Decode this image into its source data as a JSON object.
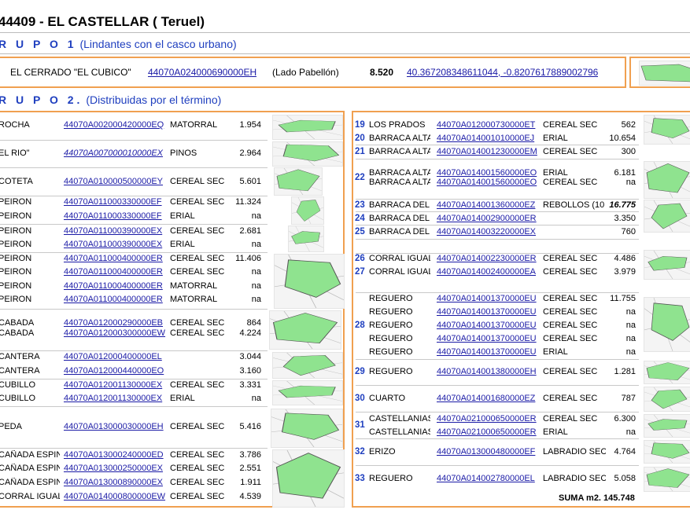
{
  "title": "44409 - EL CASTELLAR ( Teruel)",
  "group1": {
    "label": "R U P O  1",
    "subtitle": "(Lindantes con el casco urbano)",
    "parcel": {
      "name": "EL CERRADO \"EL CUBICO\"",
      "ref": "44070A024000690000EH",
      "note": "(Lado Pabellón)",
      "area": "8.520",
      "coords": "40.367208348611044, -0.8207617889002796"
    }
  },
  "group2": {
    "label": "R U P O  2.",
    "subtitle": "(Distribuidas por el término)"
  },
  "left_rows": [
    {
      "name": "ROCHA",
      "ref": "44070A002000420000EQ",
      "use": "MATORRAL",
      "area": "1.954"
    },
    {
      "name": "EL RIO\"",
      "ref": "44070A007000010000EX",
      "use": "PINOS",
      "area": "2.964"
    },
    {
      "name": "COTETA",
      "ref": "44070A010000500000EY",
      "use": "CEREAL  SEC",
      "area": "5.601"
    },
    {
      "name": "PEIRON",
      "ref": "44070A011000330000EF",
      "use": "CEREAL  SEC",
      "area": "11.324"
    },
    {
      "name": "PEIRON",
      "ref": "44070A011000330000EF",
      "use": "ERIAL",
      "area": "na"
    },
    {
      "name": "PEIRON",
      "ref": "44070A011000390000EX",
      "use": "CEREAL  SEC",
      "area": "2.681"
    },
    {
      "name": "PEIRON",
      "ref": "44070A011000390000EX",
      "use": "ERIAL",
      "area": "na"
    },
    {
      "name": "PEIRON",
      "ref": "44070A011000400000ER",
      "use": "CEREAL  SEC",
      "area": "11.406"
    },
    {
      "name": "PEIRON",
      "ref": "44070A011000400000ER",
      "use": "CEREAL  SEC",
      "area": "na"
    },
    {
      "name": "PEIRON",
      "ref": "44070A011000400000ER",
      "use": "MATORRAL",
      "area": "na"
    },
    {
      "name": "PEIRON",
      "ref": "44070A011000400000ER",
      "use": "MATORRAL",
      "area": "na"
    },
    {
      "name": "CABADA",
      "ref": "44070A012000290000EB",
      "use": "CEREAL  SEC",
      "area": "864"
    },
    {
      "name": "CABADA",
      "ref": "44070A012000300000EW",
      "use": "CEREAL  SEC",
      "area": "4.224"
    },
    {
      "name": "CANTERA",
      "ref": "44070A012000400000EL",
      "use": "",
      "area": "3.044"
    },
    {
      "name": "CANTERA",
      "ref": "44070A012000440000EO",
      "use": "",
      "area": "3.160"
    },
    {
      "name": "CUBILLO",
      "ref": "44070A012001130000EX",
      "use": "CEREAL  SEC",
      "area": "3.331"
    },
    {
      "name": "CUBILLO",
      "ref": "44070A012001130000EX",
      "use": "ERIAL",
      "area": "na"
    },
    {
      "name": "PEDA",
      "ref": "44070A013000030000EH",
      "use": "CEREAL  SEC",
      "area": "5.416"
    },
    {
      "name": "CAÑADA ESPIN",
      "ref": "44070A013000240000ED",
      "use": "CEREAL  SEC",
      "area": "3.786"
    },
    {
      "name": "CAÑADA ESPIN",
      "ref": "44070A013000250000EX",
      "use": "CEREAL  SEC",
      "area": "2.551"
    },
    {
      "name": "CAÑADA ESPIN",
      "ref": "44070A013000890000EX",
      "use": "CEREAL  SEC",
      "area": "1.911"
    },
    {
      "name": "CORRAL IGUAL",
      "ref": "44070A014000800000EW",
      "use": "CEREAL  SEC",
      "area": "4.539"
    }
  ],
  "right_rows": [
    {
      "idx": "19",
      "name": "LOS PRADOS",
      "ref": "44070A012000730000ET",
      "use": "CEREAL  SEC",
      "area": "562"
    },
    {
      "idx": "20",
      "name": "BARRACA ALTA",
      "ref": "44070A014001010000EJ",
      "use": "ERIAL",
      "area": "10.654"
    },
    {
      "idx": "21",
      "name": "BARRACA ALTA",
      "ref": "44070A014001230000EM",
      "use": "CEREAL  SEC",
      "area": "300"
    },
    {
      "idx": "22",
      "name": "BARRACA ALTA",
      "ref": "44070A014001560000EO",
      "use": "ERIAL",
      "area": "6.181"
    },
    {
      "idx": "",
      "name": "BARRACA ALTA",
      "ref": "44070A014001560000EO",
      "use": "CEREAL  SEC",
      "area": "na"
    },
    {
      "idx": "23",
      "name": "BARRACA DEL",
      "ref": "44070A014001360000EZ",
      "use": "REBOLLOS (10",
      "area": "16.775"
    },
    {
      "idx": "24",
      "name": "BARRACA DEL",
      "ref": "44070A014002900000ER",
      "use": "",
      "area": "3.350"
    },
    {
      "idx": "25",
      "name": "BARRACA DEL",
      "ref": "44070A014003220000EX",
      "use": "",
      "area": "760"
    },
    {
      "idx": "26",
      "name": "CORRAL IGUAL",
      "ref": "44070A014002230000ER",
      "use": "CEREAL  SEC",
      "area": "4.486"
    },
    {
      "idx": "27",
      "name": "CORRAL IGUAL",
      "ref": "44070A014002400000EA",
      "use": "CEREAL  SEC",
      "area": "3.979"
    },
    {
      "idx": "",
      "name": "REGUERO",
      "ref": "44070A014001370000EU",
      "use": "CEREAL  SEC",
      "area": "11.755"
    },
    {
      "idx": "",
      "name": "REGUERO",
      "ref": "44070A014001370000EU",
      "use": "CEREAL  SEC",
      "area": "na"
    },
    {
      "idx": "28",
      "name": "REGUERO",
      "ref": "44070A014001370000EU",
      "use": "CEREAL  SEC",
      "area": "na"
    },
    {
      "idx": "",
      "name": "REGUERO",
      "ref": "44070A014001370000EU",
      "use": "CEREAL  SEC",
      "area": "na"
    },
    {
      "idx": "",
      "name": "REGUERO",
      "ref": "44070A014001370000EU",
      "use": "ERIAL",
      "area": "na"
    },
    {
      "idx": "29",
      "name": "REGUERO",
      "ref": "44070A014001380000EH",
      "use": "CEREAL  SEC",
      "area": "1.281"
    },
    {
      "idx": "30",
      "name": "CUARTO",
      "ref": "44070A014001680000EZ",
      "use": "CEREAL  SEC",
      "area": "787"
    },
    {
      "idx": "31",
      "name": "CASTELLANIAS",
      "ref": "44070A021000650000ER",
      "use": "CEREAL  SEC",
      "area": "6.300"
    },
    {
      "idx": "",
      "name": "CASTELLANIAS",
      "ref": "44070A021000650000ER",
      "use": "ERIAL",
      "area": "na"
    },
    {
      "idx": "32",
      "name": "ERIZO",
      "ref": "44070A013000480000EF",
      "use": "LABRADIO SEC",
      "area": "4.764"
    },
    {
      "idx": "33",
      "name": "REGUERO",
      "ref": "44070A014002780000EL",
      "use": "LABRADIO SEC",
      "area": "5.058"
    }
  ],
  "total": "SUMA m2. 145.748"
}
